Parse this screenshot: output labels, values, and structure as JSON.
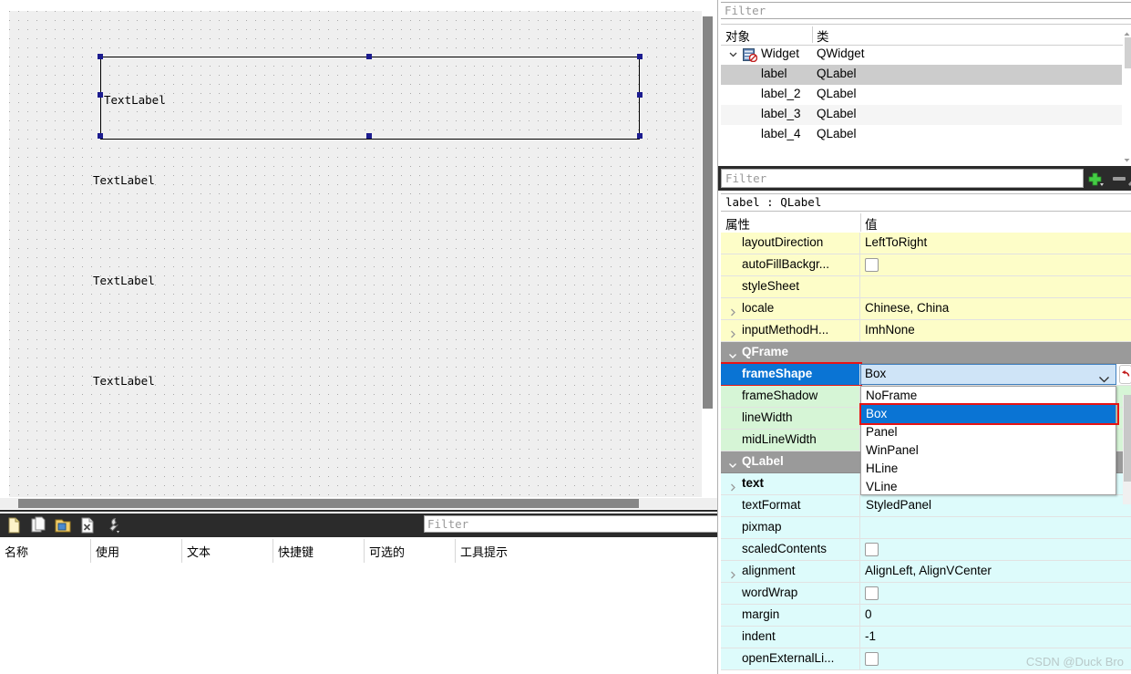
{
  "canvas": {
    "selected_label": {
      "text": "TextLabel",
      "name": "label"
    },
    "labels": [
      {
        "text": "TextLabel"
      },
      {
        "text": "TextLabel"
      },
      {
        "text": "TextLabel"
      }
    ]
  },
  "action_editor": {
    "filter_placeholder": "Filter",
    "toolbar_icons": [
      "new-action-icon",
      "copy-action-icon",
      "edit-action-icon",
      "delete-action-icon",
      "configure-icon"
    ],
    "columns": [
      "名称",
      "使用",
      "文本",
      "快捷键",
      "可选的",
      "工具提示"
    ]
  },
  "object_inspector": {
    "filter_placeholder": "Filter",
    "columns": [
      "对象",
      "类"
    ],
    "rows": [
      {
        "name": "Widget",
        "class": "QWidget",
        "depth": 0,
        "expanded": true,
        "selected": false
      },
      {
        "name": "label",
        "class": "QLabel",
        "depth": 1,
        "expanded": false,
        "selected": true
      },
      {
        "name": "label_2",
        "class": "QLabel",
        "depth": 1,
        "expanded": false,
        "selected": false
      },
      {
        "name": "label_3",
        "class": "QLabel",
        "depth": 1,
        "expanded": false,
        "selected": false
      },
      {
        "name": "label_4",
        "class": "QLabel",
        "depth": 1,
        "expanded": false,
        "selected": false
      }
    ]
  },
  "property_editor": {
    "filter_placeholder": "Filter",
    "object_line": "label : QLabel",
    "columns": [
      "属性",
      "值"
    ],
    "add_label": "+",
    "remove_label": "−",
    "rows": [
      {
        "kind": "prop",
        "name": "layoutDirection",
        "value": "LeftToRight",
        "band": "yellow",
        "expandable": false,
        "checkbox": false
      },
      {
        "kind": "prop",
        "name": "autoFillBackgr...",
        "value": "",
        "band": "yellow",
        "expandable": false,
        "checkbox": true
      },
      {
        "kind": "prop",
        "name": "styleSheet",
        "value": "",
        "band": "yellow",
        "expandable": false,
        "checkbox": false
      },
      {
        "kind": "prop",
        "name": "locale",
        "value": "Chinese, China",
        "band": "yellow",
        "expandable": true,
        "checkbox": false
      },
      {
        "kind": "prop",
        "name": "inputMethodH...",
        "value": "ImhNone",
        "band": "yellow",
        "expandable": true,
        "checkbox": false
      },
      {
        "kind": "section",
        "name": "QFrame"
      },
      {
        "kind": "editing",
        "name": "frameShape",
        "value": "Box",
        "band": "green"
      },
      {
        "kind": "prop",
        "name": "frameShadow",
        "value": "",
        "band": "green",
        "expandable": false,
        "checkbox": false
      },
      {
        "kind": "prop",
        "name": "lineWidth",
        "value": "",
        "band": "green",
        "expandable": false,
        "checkbox": false
      },
      {
        "kind": "prop",
        "name": "midLineWidth",
        "value": "",
        "band": "green",
        "expandable": false,
        "checkbox": false
      },
      {
        "kind": "section",
        "name": "QLabel"
      },
      {
        "kind": "prop",
        "name": "text",
        "value": "",
        "band": "cyan",
        "expandable": true,
        "checkbox": false,
        "bold": true
      },
      {
        "kind": "prop",
        "name": "textFormat",
        "value": "",
        "band": "cyan",
        "expandable": false,
        "checkbox": false
      },
      {
        "kind": "prop",
        "name": "pixmap",
        "value": "",
        "band": "cyan",
        "expandable": false,
        "checkbox": false
      },
      {
        "kind": "prop",
        "name": "scaledContents",
        "value": "",
        "band": "cyan",
        "expandable": false,
        "checkbox": true
      },
      {
        "kind": "prop",
        "name": "alignment",
        "value": "AlignLeft, AlignVCenter",
        "band": "cyan",
        "expandable": true,
        "checkbox": false
      },
      {
        "kind": "prop",
        "name": "wordWrap",
        "value": "",
        "band": "cyan",
        "expandable": false,
        "checkbox": true
      },
      {
        "kind": "prop",
        "name": "margin",
        "value": "0",
        "band": "cyan",
        "expandable": false,
        "checkbox": false
      },
      {
        "kind": "prop",
        "name": "indent",
        "value": "-1",
        "band": "cyan",
        "expandable": false,
        "checkbox": false
      },
      {
        "kind": "prop",
        "name": "openExternalLi...",
        "value": "",
        "band": "cyan",
        "expandable": false,
        "checkbox": true
      }
    ],
    "combo": {
      "current": "Box",
      "options": [
        "NoFrame",
        "Box",
        "Panel",
        "WinPanel",
        "HLine",
        "VLine",
        "StyledPanel"
      ],
      "selected_option": "Box",
      "reset_tooltip": "reset-property"
    },
    "highlight_color": "#e81313",
    "selection_color": "#0a74d4"
  },
  "watermark": "CSDN @Duck Bro"
}
